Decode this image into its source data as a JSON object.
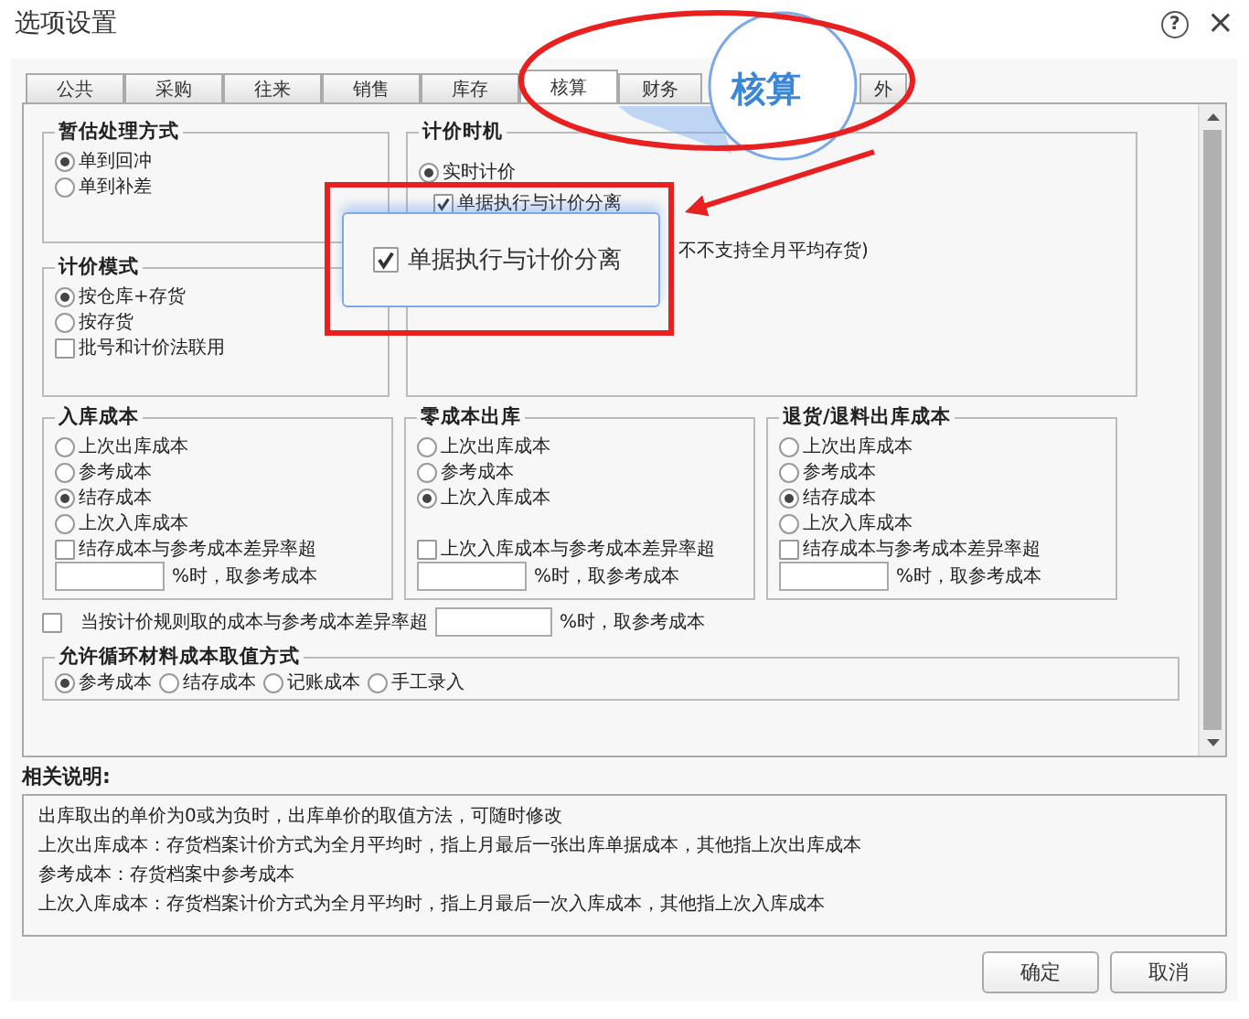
{
  "window": {
    "title": "选项设置",
    "help": "?",
    "close": "×"
  },
  "tabs": [
    {
      "label": "公共",
      "selected": false
    },
    {
      "label": "采购",
      "selected": false
    },
    {
      "label": "往来",
      "selected": false
    },
    {
      "label": "销售",
      "selected": false
    },
    {
      "label": "库存",
      "selected": false
    },
    {
      "label": "核算",
      "selected": true
    },
    {
      "label": "财务",
      "selected": false
    },
    {
      "label": "外",
      "selected": false
    }
  ],
  "estimate": {
    "title": "暂估处理方式",
    "options": [
      {
        "label": "单到回冲",
        "selected": true
      },
      {
        "label": "单到补差",
        "selected": false
      }
    ]
  },
  "pricing_mode": {
    "title": "计价模式",
    "options": [
      {
        "label": "按仓库+存货",
        "selected": true
      },
      {
        "label": "按存货",
        "selected": false
      }
    ],
    "checkbox": {
      "label": "批号和计价法联用",
      "checked": false
    }
  },
  "pricing_timing": {
    "title": "计价时机",
    "options": [
      {
        "label": "实时计价",
        "selected": true
      }
    ],
    "checkbox": {
      "label": "单据执行与计价分离",
      "checked": true
    },
    "note": "不不支持全月平均存货)"
  },
  "cost_groups": [
    {
      "title": "入库成本",
      "options": [
        {
          "label": "上次出库成本",
          "selected": false
        },
        {
          "label": "参考成本",
          "selected": false
        },
        {
          "label": "结存成本",
          "selected": true
        },
        {
          "label": "上次入库成本",
          "selected": false
        }
      ],
      "threshold": {
        "label": "结存成本与参考成本差异率超",
        "checked": false,
        "suffix": "%时，取参考成本"
      }
    },
    {
      "title": "零成本出库",
      "options": [
        {
          "label": "上次出库成本",
          "selected": false
        },
        {
          "label": "参考成本",
          "selected": false
        },
        {
          "label": "上次入库成本",
          "selected": true
        }
      ],
      "threshold": {
        "label": "上次入库成本与参考成本差异率超",
        "checked": false,
        "suffix": "%时，取参考成本"
      }
    },
    {
      "title": "退货/退料出库成本",
      "options": [
        {
          "label": "上次出库成本",
          "selected": false
        },
        {
          "label": "参考成本",
          "selected": false
        },
        {
          "label": "结存成本",
          "selected": true
        },
        {
          "label": "上次入库成本",
          "selected": false
        }
      ],
      "threshold": {
        "label": "结存成本与参考成本差异率超",
        "checked": false,
        "suffix": "%时，取参考成本"
      }
    }
  ],
  "rule_threshold": {
    "label": "当按计价规则取的成本与参考成本差异率超",
    "checked": false,
    "suffix": "%时，取参考成本"
  },
  "loop_material": {
    "title": "允许循环材料成本取值方式",
    "options": [
      {
        "label": "参考成本",
        "selected": true
      },
      {
        "label": "结存成本",
        "selected": false
      },
      {
        "label": "记账成本",
        "selected": false
      },
      {
        "label": "手工录入",
        "selected": false
      }
    ]
  },
  "description": {
    "title": "相关说明:",
    "lines": [
      "出库取出的单价为0或为负时，出库单价的取值方法，可随时修改",
      "上次出库成本：存货档案计价方式为全月平均时，指上月最后一张出库单据成本，其他指上次出库成本",
      "参考成本：存货档案中参考成本",
      "上次入库成本：存货档案计价方式为全月平均时，指上月最后一次入库成本，其他指上次入库成本"
    ]
  },
  "buttons": [
    {
      "label": "确定"
    },
    {
      "label": "取消"
    }
  ],
  "callouts": {
    "magnifier": {
      "label": "核算"
    },
    "popup": {
      "label": "单据执行与计价分离",
      "checked": true
    }
  }
}
